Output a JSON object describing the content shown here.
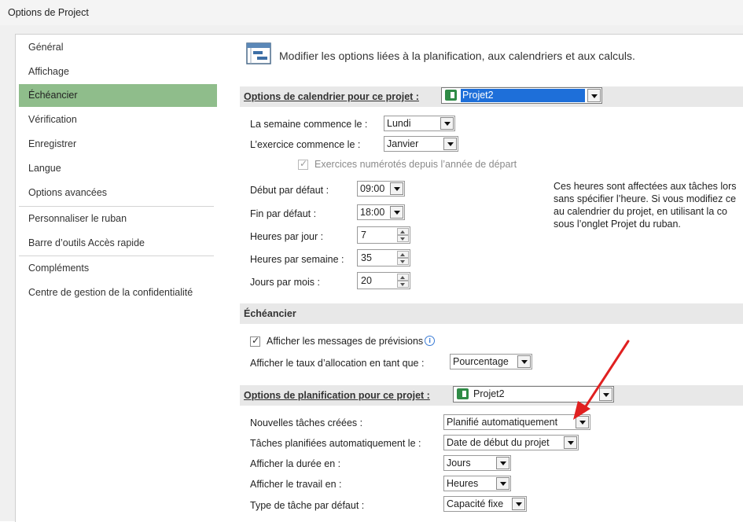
{
  "window": {
    "title": "Options de Project"
  },
  "nav": {
    "items": [
      "Général",
      "Affichage",
      "Échéancier",
      "Vérification",
      "Enregistrer",
      "Langue",
      "Options avancées",
      "Personnaliser le ruban",
      "Barre d’outils Accès rapide",
      "Compléments",
      "Centre de gestion de la confidentialité"
    ],
    "selected": "Échéancier"
  },
  "header": {
    "text": "Modifier les options liées à la planification, aux calendriers et aux calculs."
  },
  "calendar": {
    "section_label": "Options de calendrier pour ce projet :",
    "project_value": "Projet2",
    "week_start_label": "La semaine commence le :",
    "week_start_value": "Lundi",
    "fiscal_label": "L’exercice commence le :",
    "fiscal_value": "Janvier",
    "fiscal_numbering_label": "Exercices numérotés depuis l’année de départ",
    "default_start_label": "Début par défaut :",
    "default_start_value": "09:00",
    "default_end_label": "Fin par défaut :",
    "default_end_value": "18:00",
    "hours_day_label": "Heures par jour :",
    "hours_day_value": "7",
    "hours_week_label": "Heures par semaine :",
    "hours_week_value": "35",
    "days_month_label": "Jours par mois :",
    "days_month_value": "20",
    "info_lines": [
      "Ces heures sont affectées aux tâches lors",
      "sans spécifier l’heure. Si vous modifiez ce",
      "au calendrier du projet, en utilisant la co",
      "sous l’onglet Projet du ruban."
    ]
  },
  "schedule": {
    "section_label": "Échéancier",
    "show_messages_label": "Afficher les messages de prévisions",
    "show_messages_checked": true,
    "allocation_label": "Afficher le taux d’allocation en tant que :",
    "allocation_value": "Pourcentage"
  },
  "planning": {
    "section_label": "Options de planification pour ce projet :",
    "project_value": "Projet2",
    "new_tasks_label": "Nouvelles tâches créées :",
    "new_tasks_value": "Planifié automatiquement",
    "auto_tasks_label": "Tâches planifiées automatiquement le :",
    "auto_tasks_value": "Date de début du projet",
    "duration_label": "Afficher la durée en :",
    "duration_value": "Jours",
    "work_label": "Afficher le travail en :",
    "work_value": "Heures",
    "task_type_label": "Type de tâche par défaut :",
    "task_type_value": "Capacité fixe"
  },
  "colors": {
    "selected_nav": "#8fbd8b",
    "section_bg": "#e8e8e8",
    "project_field": "#1e6fd9",
    "arrow": "#e02020"
  }
}
